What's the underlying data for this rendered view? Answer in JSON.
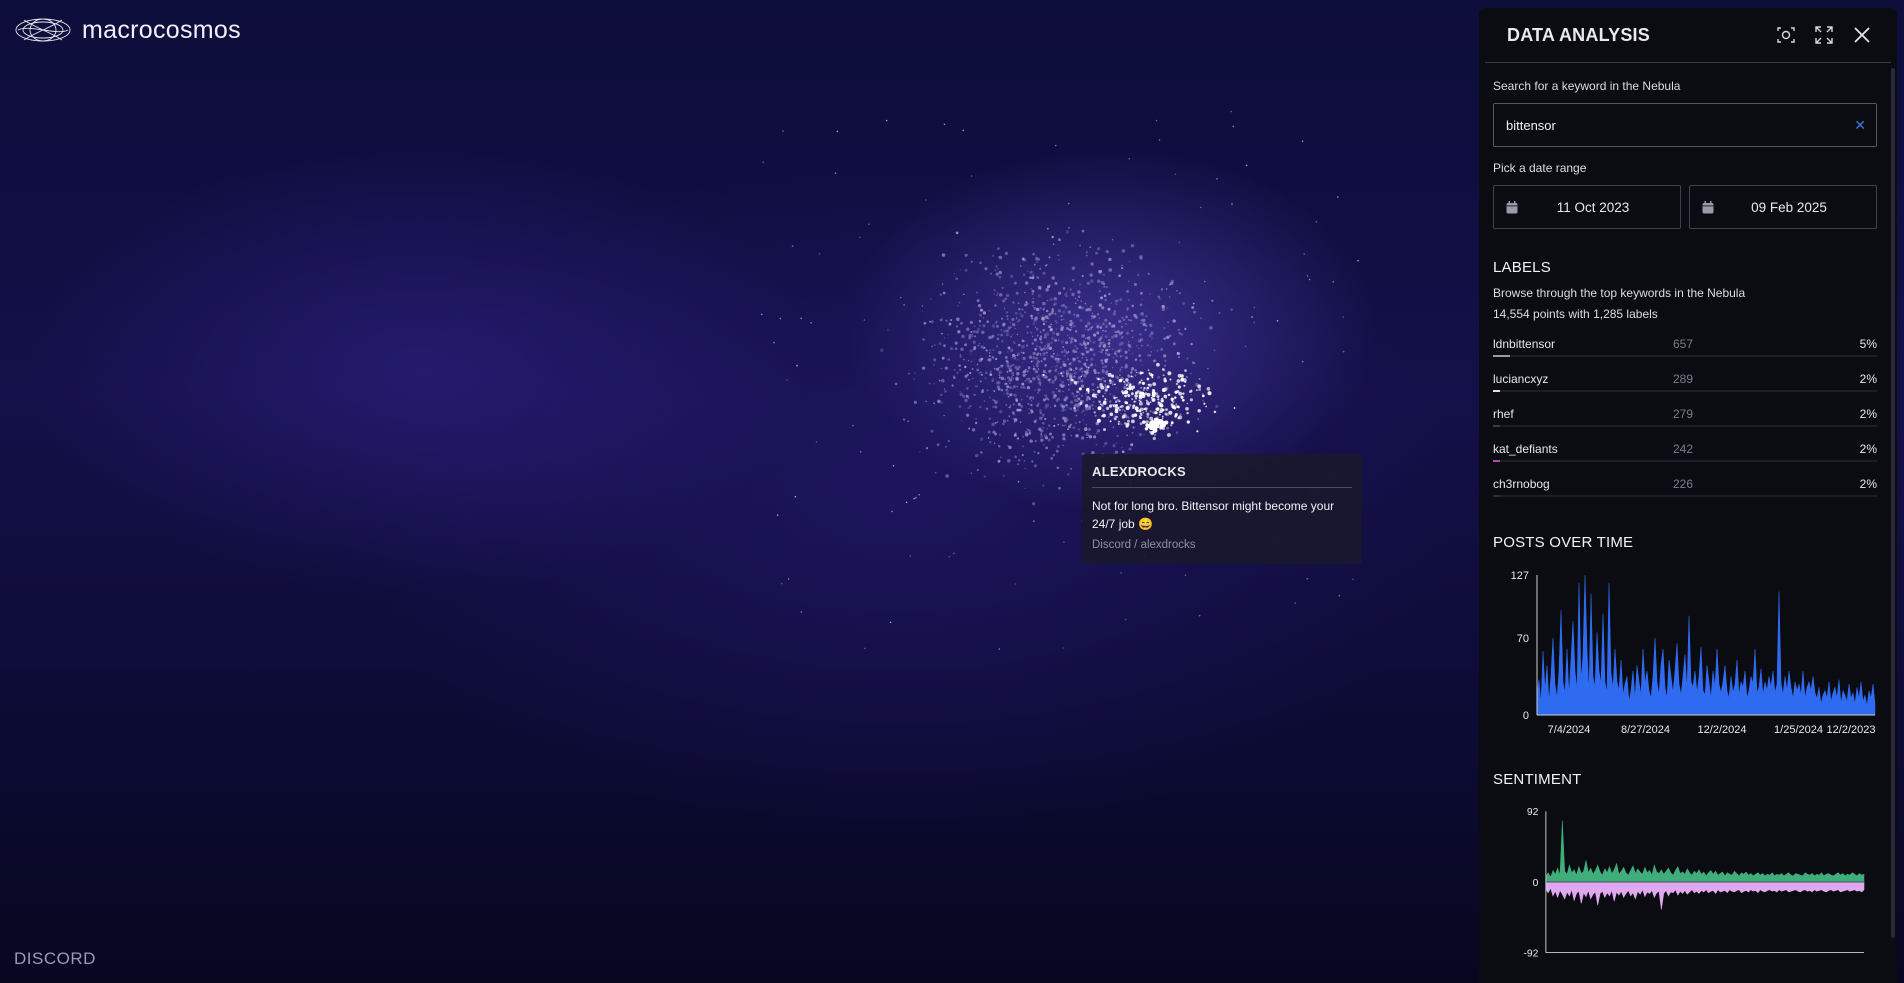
{
  "brand": {
    "name": "macrocosmos"
  },
  "bottom_label": "DISCORD",
  "tooltip": {
    "author": "ALEXDROCKS",
    "message": "Not for long bro. Bittensor might become your 24/7 job 😄",
    "source": "Discord / alexdrocks"
  },
  "panel": {
    "title": "DATA ANALYSIS",
    "search_label": "Search for a keyword in the Nebula",
    "search_value": "bittensor",
    "date_label": "Pick a date range",
    "date_from": "11 Oct 2023",
    "date_to": "09 Feb 2025",
    "labels_title": "LABELS",
    "labels_subtitle": "Browse through the top keywords in the Nebula",
    "labels_summary": "14,554 points with 1,285 labels",
    "labels": [
      {
        "name": "ldnbittensor",
        "count": "657",
        "percent": "5%",
        "share": 0.05,
        "color": "#9a9aa8"
      },
      {
        "name": "luciancxyz",
        "count": "289",
        "percent": "2%",
        "share": 0.02,
        "color": "#f0d4e8"
      },
      {
        "name": "rhef",
        "count": "279",
        "percent": "2%",
        "share": 0.02,
        "color": "#3a3a50"
      },
      {
        "name": "kat_defiants",
        "count": "242",
        "percent": "2%",
        "share": 0.02,
        "color": "#c03fa8"
      },
      {
        "name": "ch3rnobog",
        "count": "226",
        "percent": "2%",
        "share": 0.02,
        "color": "#2a2a40"
      }
    ],
    "posts_title": "POSTS OVER TIME",
    "sentiment_title": "SENTIMENT"
  },
  "chart_data": [
    {
      "type": "area",
      "title": "POSTS OVER TIME",
      "yticks": [
        "127",
        "70",
        "0"
      ],
      "xticks": [
        "7/4/2024",
        "8/27/2024",
        "12/2/2024",
        "1/25/2024",
        "12/2/2023"
      ],
      "ylim": [
        0,
        127
      ],
      "color": "#2f6bf0",
      "values": [
        18,
        32,
        10,
        58,
        22,
        45,
        12,
        36,
        70,
        28,
        15,
        40,
        95,
        30,
        20,
        60,
        18,
        50,
        85,
        40,
        22,
        120,
        30,
        55,
        127,
        60,
        20,
        110,
        35,
        25,
        75,
        40,
        28,
        92,
        30,
        20,
        120,
        38,
        24,
        60,
        30,
        22,
        50,
        18,
        28,
        35,
        12,
        22,
        40,
        15,
        45,
        30,
        18,
        60,
        28,
        40,
        22,
        15,
        35,
        70,
        30,
        18,
        45,
        60,
        25,
        15,
        50,
        35,
        20,
        40,
        65,
        28,
        18,
        35,
        55,
        22,
        90,
        30,
        25,
        40,
        20,
        35,
        62,
        22,
        18,
        45,
        30,
        15,
        40,
        25,
        60,
        28,
        20,
        30,
        45,
        22,
        15,
        35,
        20,
        28,
        50,
        18,
        30,
        25,
        40,
        15,
        22,
        35,
        28,
        60,
        20,
        25,
        42,
        18,
        30,
        22,
        35,
        25,
        40,
        20,
        28,
        112,
        30,
        18,
        35,
        22,
        40,
        25,
        15,
        30,
        22,
        28,
        18,
        40,
        15,
        25,
        30,
        22,
        35,
        20,
        15,
        25,
        10,
        18,
        22,
        15,
        30,
        12,
        20,
        25,
        15,
        32,
        10,
        22,
        18,
        12,
        28,
        15,
        20,
        10,
        25,
        15,
        30,
        12,
        18,
        8,
        22,
        15,
        28,
        10
      ]
    },
    {
      "type": "area",
      "title": "SENTIMENT",
      "yticks": [
        "92",
        "0",
        "-92"
      ],
      "ylim": [
        -92,
        92
      ],
      "series": [
        {
          "name": "positive",
          "color": "#3fae7a",
          "values": [
            8,
            12,
            6,
            15,
            10,
            18,
            9,
            80,
            14,
            10,
            22,
            12,
            16,
            9,
            20,
            11,
            14,
            28,
            12,
            18,
            10,
            15,
            22,
            13,
            9,
            17,
            12,
            20,
            11,
            16,
            24,
            10,
            14,
            19,
            12,
            9,
            15,
            21,
            11,
            17,
            13,
            10,
            19,
            12,
            15,
            9,
            22,
            13,
            11,
            16,
            10,
            14,
            18,
            12,
            9,
            15,
            20,
            11,
            13,
            10,
            17,
            12,
            9,
            14,
            11,
            16,
            10,
            13,
            8,
            12,
            15,
            10,
            14,
            9,
            11,
            13,
            8,
            12,
            10,
            9,
            14,
            11,
            8,
            12,
            10,
            13,
            9,
            11,
            8,
            10,
            12,
            9,
            11,
            8,
            10,
            9,
            12,
            8,
            10,
            9,
            11,
            8,
            10,
            12,
            9,
            8,
            11,
            10,
            9,
            8,
            12,
            10,
            9,
            11,
            8,
            10,
            9,
            12,
            8,
            10,
            11,
            9,
            8,
            10,
            12,
            9,
            11,
            8,
            10,
            9,
            12,
            10,
            8,
            11,
            9,
            10
          ]
        },
        {
          "name": "negative",
          "color": "#e0a8f0",
          "values": [
            -10,
            -14,
            -8,
            -18,
            -12,
            -20,
            -11,
            -16,
            -22,
            -13,
            -18,
            -10,
            -24,
            -15,
            -12,
            -28,
            -14,
            -19,
            -11,
            -22,
            -16,
            -13,
            -30,
            -15,
            -12,
            -20,
            -14,
            -18,
            -11,
            -25,
            -13,
            -17,
            -12,
            -20,
            -15,
            -11,
            -18,
            -14,
            -22,
            -12,
            -16,
            -10,
            -19,
            -13,
            -15,
            -11,
            -20,
            -14,
            -12,
            -36,
            -15,
            -11,
            -18,
            -13,
            -14,
            -10,
            -17,
            -12,
            -15,
            -11,
            -16,
            -13,
            -10,
            -14,
            -12,
            -15,
            -11,
            -13,
            -10,
            -14,
            -12,
            -11,
            -15,
            -10,
            -13,
            -12,
            -11,
            -14,
            -10,
            -12,
            -13,
            -11,
            -10,
            -14,
            -12,
            -11,
            -13,
            -10,
            -12,
            -11,
            -14,
            -10,
            -12,
            -13,
            -11,
            -10,
            -12,
            -11,
            -13,
            -10,
            -12,
            -11,
            -10,
            -13,
            -12,
            -11,
            -10,
            -12,
            -13,
            -11,
            -10,
            -12,
            -11,
            -13,
            -10,
            -12,
            -11,
            -10,
            -12,
            -13,
            -11,
            -10,
            -12,
            -11,
            -10,
            -13,
            -12,
            -11,
            -10,
            -12,
            -11,
            -10,
            -12,
            -11,
            -13,
            -10
          ]
        }
      ]
    }
  ]
}
